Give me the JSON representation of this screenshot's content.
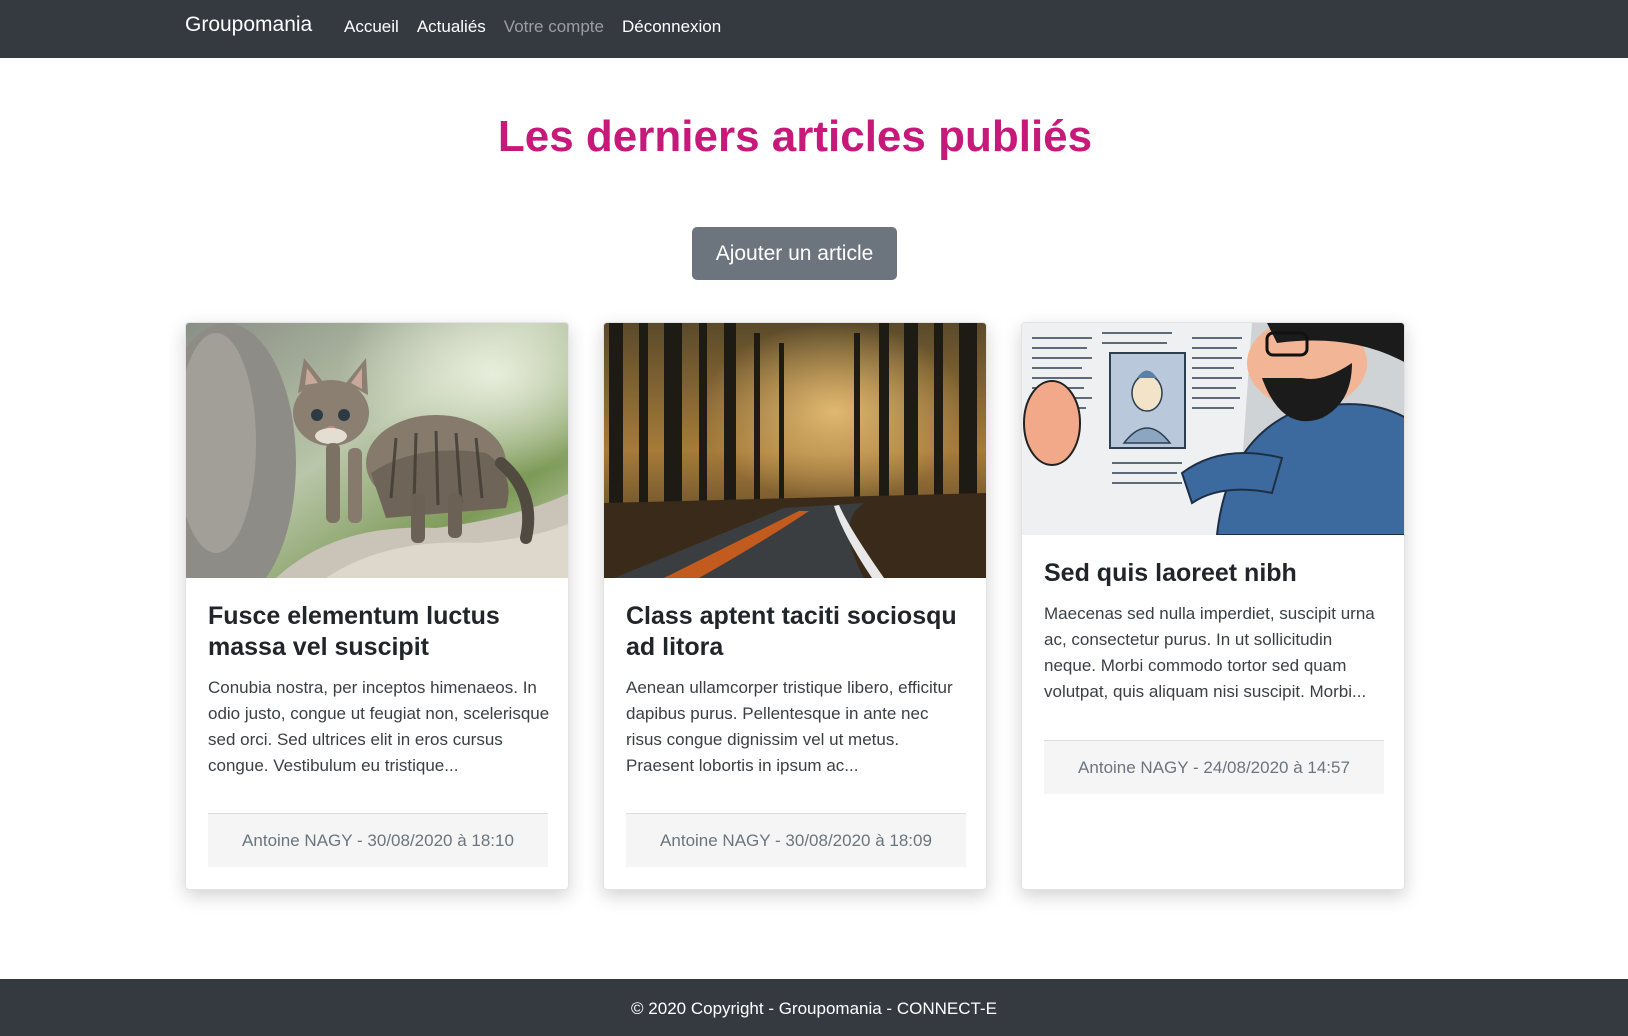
{
  "navbar": {
    "brand": "Groupomania",
    "links": [
      {
        "label": "Accueil"
      },
      {
        "label": "Actualiés"
      },
      {
        "label": "Votre compte"
      },
      {
        "label": "Déconnexion"
      }
    ]
  },
  "main": {
    "title": "Les derniers articles publiés",
    "add_button": "Ajouter un article"
  },
  "articles": [
    {
      "title": "Fusce elementum luctus massa vel suscipit",
      "excerpt": "Conubia nostra, per inceptos himenaeos. In odio justo, congue ut feugiat non, scelerisque sed orci. Sed ultrices elit in eros cursus congue. Vestibulum eu tristique...",
      "meta": "Antoine NAGY - 30/08/2020 à 18:10",
      "image": "kitten-photo"
    },
    {
      "title": "Class aptent taciti sociosqu ad litora",
      "excerpt": "Aenean ullamcorper tristique libero, efficitur dapibus purus. Pellentesque in ante nec risus congue dignissim vel ut metus. Praesent lobortis in ipsum ac...",
      "meta": "Antoine NAGY - 30/08/2020 à 18:09",
      "image": "forest-road-photo"
    },
    {
      "title": "Sed quis laoreet nibh",
      "excerpt": "Maecenas sed nulla imperdiet, suscipit urna ac, consectetur purus. In ut sollicitudin neque. Morbi commodo tortor sed quam volutpat, quis aliquam nisi suscipit. Morbi...",
      "meta": "Antoine NAGY - 24/08/2020 à 14:57",
      "image": "comic-newspaper-illustration"
    }
  ],
  "footer": {
    "text": "© 2020 Copyright - Groupomania - CONNECT-E"
  },
  "colors": {
    "navbar": "#343a40",
    "title": "#c6197a",
    "button": "#6c757d"
  }
}
